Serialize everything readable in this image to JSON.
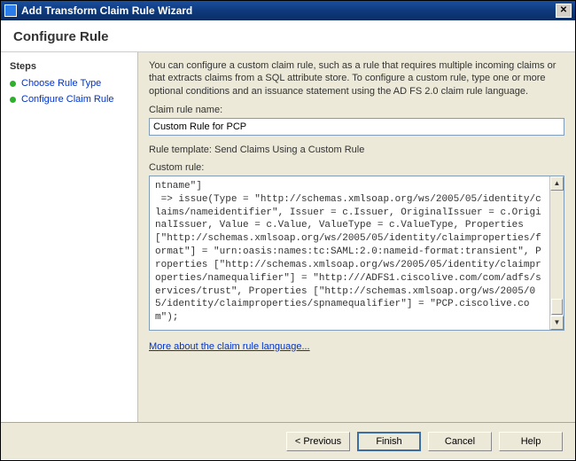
{
  "window": {
    "title": "Add Transform Claim Rule Wizard"
  },
  "header": {
    "title": "Configure Rule"
  },
  "sidebar": {
    "heading": "Steps",
    "items": [
      {
        "label": "Choose Rule Type"
      },
      {
        "label": "Configure Claim Rule"
      }
    ]
  },
  "content": {
    "intro": "You can configure a custom claim rule, such as a rule that requires multiple incoming claims or that extracts claims from a SQL attribute store. To configure a custom rule, type one or more optional conditions and an issuance statement using the AD FS 2.0 claim rule language.",
    "name_label": "Claim rule name:",
    "name_value": "Custom Rule for PCP",
    "template_line": "Rule template: Send Claims Using a Custom Rule",
    "custom_label": "Custom rule:",
    "rule_text": "ntname\"]\n => issue(Type = \"http://schemas.xmlsoap.org/ws/2005/05/identity/claims/nameidentifier\", Issuer = c.Issuer, OriginalIssuer = c.OriginalIssuer, Value = c.Value, ValueType = c.ValueType, Properties [\"http://schemas.xmlsoap.org/ws/2005/05/identity/claimproperties/format\"] = \"urn:oasis:names:tc:SAML:2.0:nameid-format:transient\", Properties [\"http://schemas.xmlsoap.org/ws/2005/05/identity/claimproperties/namequalifier\"] = \"http:///ADFS1.ciscolive.com/com/adfs/services/trust\", Properties [\"http://schemas.xmlsoap.org/ws/2005/05/identity/claimproperties/spnamequalifier\"] = \"PCP.ciscolive.com\");",
    "more_link": "More about the claim rule language..."
  },
  "buttons": {
    "previous": "< Previous",
    "finish": "Finish",
    "cancel": "Cancel",
    "help": "Help"
  }
}
